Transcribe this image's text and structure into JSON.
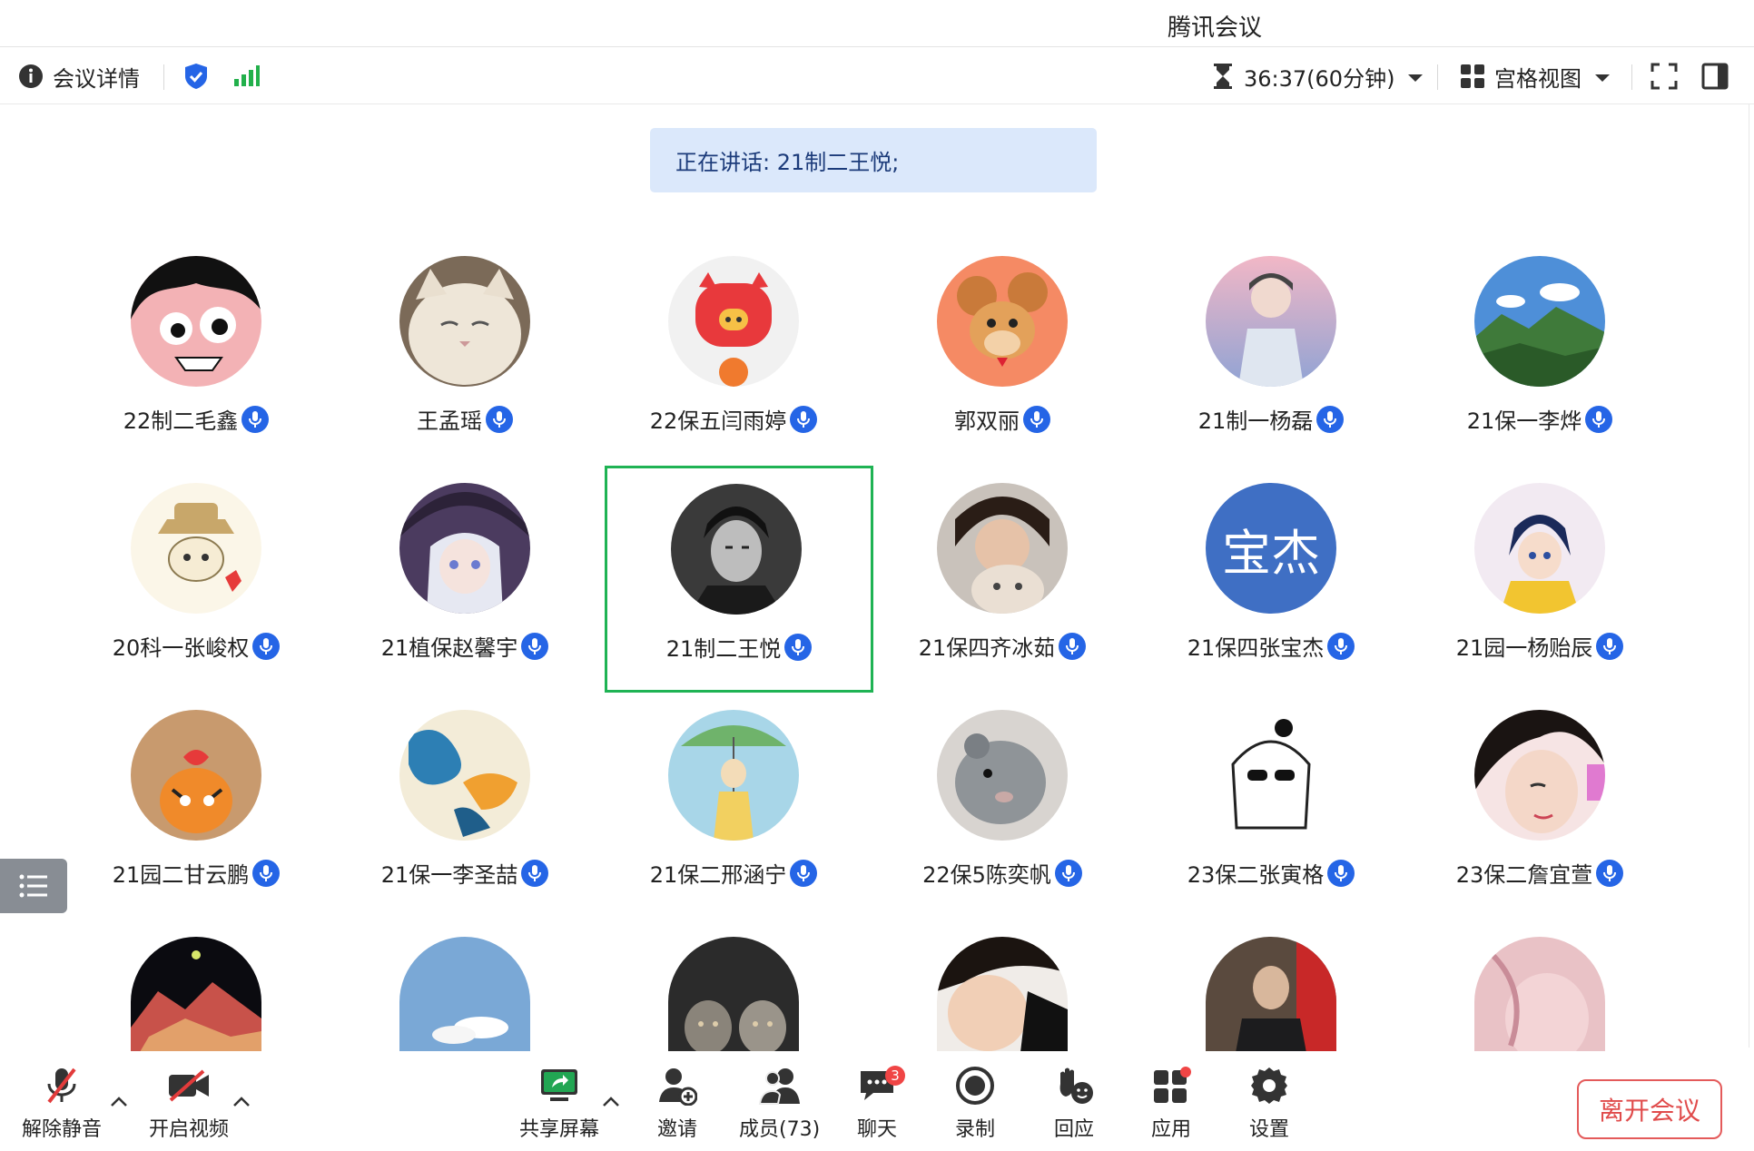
{
  "window": {
    "title": "腾讯会议"
  },
  "toolbar": {
    "meeting_details": "会议详情",
    "timer": "36:37(60分钟)",
    "view_mode": "宫格视图"
  },
  "speaking": {
    "label": "正在讲话: 21制二王悦;"
  },
  "participants": [
    {
      "name": "22制二毛鑫",
      "avatar": "anime-boy-icon"
    },
    {
      "name": "王孟瑶",
      "avatar": "white-cat-icon"
    },
    {
      "name": "22保五闫雨婷",
      "avatar": "red-pig-icon"
    },
    {
      "name": "郭双丽",
      "avatar": "cartoon-mouse-icon"
    },
    {
      "name": "21制一杨磊",
      "avatar": "anime-sky-boy-icon"
    },
    {
      "name": "21保一李烨",
      "avatar": "mountain-landscape-icon"
    },
    {
      "name": "20科一张峻权",
      "avatar": "cartoon-detective-icon"
    },
    {
      "name": "21植保赵馨宇",
      "avatar": "anime-witch-icon"
    },
    {
      "name": "21制二王悦",
      "avatar": "bw-portrait-icon"
    },
    {
      "name": "21保四齐冰茹",
      "avatar": "girl-with-cat-icon"
    },
    {
      "name": "21保四张宝杰",
      "avatar_text": "宝杰"
    },
    {
      "name": "21园一杨贻辰",
      "avatar": "anime-yellow-hoodie-icon"
    },
    {
      "name": "21园二甘云鹏",
      "avatar": "tiger-sticker-icon"
    },
    {
      "name": "21保一李圣喆",
      "avatar": "paint-splash-icon"
    },
    {
      "name": "21保二邢涵宁",
      "avatar": "umbrella-illustration-icon"
    },
    {
      "name": "22保5陈奕帆",
      "avatar": "hamster-icon"
    },
    {
      "name": "23保二张寅格",
      "avatar": "sketch-sunglasses-icon"
    },
    {
      "name": "23保二詹宜萱",
      "avatar": "girl-selfie-icon"
    },
    {
      "name": "",
      "avatar": "night-mountain-icon"
    },
    {
      "name": "",
      "avatar": "blue-sky-icon"
    },
    {
      "name": "",
      "avatar": "cats-icon"
    },
    {
      "name": "",
      "avatar": "boy-closeup-icon"
    },
    {
      "name": "",
      "avatar": "man-suit-icon"
    },
    {
      "name": "",
      "avatar": "pink-portrait-icon"
    }
  ],
  "bottom": {
    "unmute": "解除静音",
    "start_video": "开启视频",
    "share_screen": "共享屏幕",
    "invite": "邀请",
    "members": "成员(73)",
    "chat": "聊天",
    "chat_badge": "3",
    "record": "录制",
    "react": "回应",
    "apps": "应用",
    "settings": "设置",
    "leave": "离开会议"
  },
  "colors": {
    "accent": "#2565e6",
    "active_border": "#1fb354",
    "leave": "#e04b4b",
    "speaking_bg": "#dbe8fb"
  }
}
